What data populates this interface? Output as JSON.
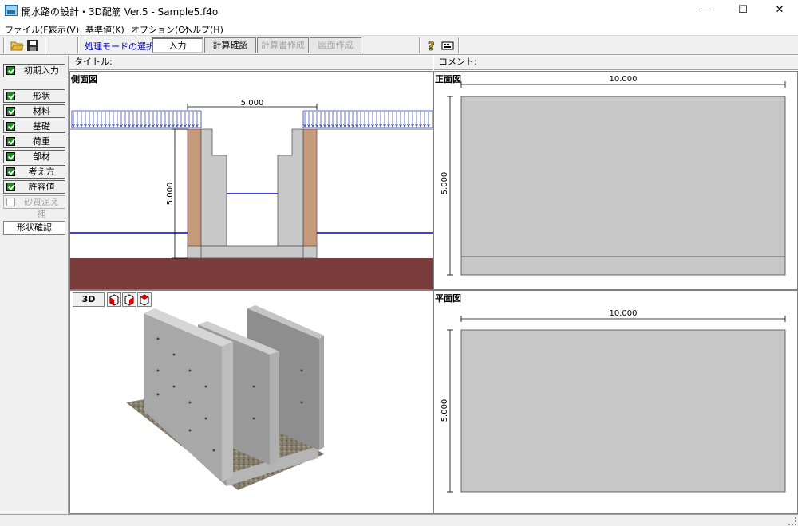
{
  "window": {
    "title": "開水路の設計・3D配筋 Ver.5 - Sample5.f4o",
    "minimize": "—",
    "maximize": "☐",
    "close": "✕"
  },
  "menu": {
    "items": [
      "ファイル(F)",
      "表示(V)",
      "基準値(K)",
      "オプション(O)",
      "ヘルプ(H)"
    ]
  },
  "toolbar": {
    "mode_label": "処理モードの選択",
    "modes": [
      {
        "label": "入力",
        "state": "active"
      },
      {
        "label": "計算確認",
        "state": "enabled"
      },
      {
        "label": "計算書作成",
        "state": "disabled"
      },
      {
        "label": "図面作成",
        "state": "disabled"
      }
    ],
    "icons": [
      "open-folder-icon",
      "save-icon",
      "help-icon",
      "keyboard-icon"
    ]
  },
  "sidebar": {
    "items": [
      {
        "label": "初期入力",
        "checked": true,
        "enabled": true
      },
      {
        "label": "形状",
        "checked": true,
        "enabled": true
      },
      {
        "label": "材料",
        "checked": true,
        "enabled": true
      },
      {
        "label": "基礎",
        "checked": true,
        "enabled": true
      },
      {
        "label": "荷重",
        "checked": true,
        "enabled": true
      },
      {
        "label": "部材",
        "checked": true,
        "enabled": true
      },
      {
        "label": "考え方",
        "checked": true,
        "enabled": true
      },
      {
        "label": "許容値",
        "checked": true,
        "enabled": true
      },
      {
        "label": "砂質泥え補",
        "checked": false,
        "enabled": false
      }
    ],
    "shape_check": "形状確認"
  },
  "info": {
    "title_label": "タイトル:",
    "comment_label": "コメント:"
  },
  "panels": {
    "side_view": {
      "title": "側面図",
      "width_dim": "5.000",
      "height_dim": "5.000"
    },
    "front_view": {
      "title": "正面図",
      "width_dim": "10.000",
      "height_dim": "5.000"
    },
    "view_3d": {
      "button": "3D"
    },
    "plan_view": {
      "title": "平面図",
      "width_dim": "10.000",
      "height_dim": "5.000"
    }
  },
  "colors": {
    "load_arrows": "#2a3ea6",
    "water_line": "#0000c8",
    "ground": "#7a3b3b",
    "backfill": "#c49a7a",
    "concrete": "#c8c8c8"
  }
}
